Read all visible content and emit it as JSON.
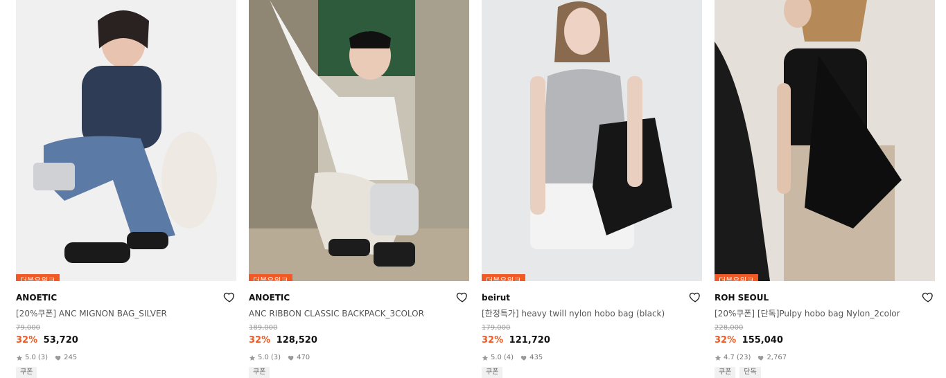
{
  "products": [
    {
      "badge": "더블유위크",
      "brand": "ANOETIC",
      "name": "[20%쿠폰] ANC MIGNON BAG_SILVER",
      "original_price": "79,000",
      "discount": "32%",
      "price": "53,720",
      "rating": "5.0",
      "review_count": "(3)",
      "likes": "245",
      "tags": [
        "쿠폰"
      ],
      "image": {
        "bg": "#f0f0f1",
        "figure": "#2f3c55",
        "accent": "#5c7aa6",
        "bag": "#cfd1d4"
      }
    },
    {
      "badge": "더블유위크",
      "brand": "ANOETIC",
      "name": "ANC RIBBON CLASSIC BACKPACK_3COLOR",
      "original_price": "189,000",
      "discount": "32%",
      "price": "128,520",
      "rating": "5.0",
      "review_count": "(3)",
      "likes": "470",
      "tags": [
        "쿠폰"
      ],
      "image": {
        "bg": "#c9c3b6",
        "figure": "#f2f2f0",
        "accent": "#7aa2b8",
        "bag": "#d8d9db"
      }
    },
    {
      "badge": "더블유위크",
      "brand": "beirut",
      "name": "[한정특가] heavy twill nylon hobo bag (black)",
      "original_price": "179,000",
      "discount": "32%",
      "price": "121,720",
      "rating": "5.0",
      "review_count": "(4)",
      "likes": "435",
      "tags": [
        "쿠폰"
      ],
      "image": {
        "bg": "#e7e8ea",
        "figure": "#b5b6b9",
        "accent": "#f3f3f3",
        "bag": "#161616"
      }
    },
    {
      "badge": "더블유위크",
      "brand": "ROH SEOUL",
      "name": "[20%쿠폰] [단독]Pulpy hobo bag Nylon_2color",
      "original_price": "228,000",
      "discount": "32%",
      "price": "155,040",
      "rating": "4.7",
      "review_count": "(23)",
      "likes": "2,767",
      "tags": [
        "쿠폰",
        "단독"
      ],
      "image": {
        "bg": "#e4dfd8",
        "figure": "#141414",
        "accent": "#c9b9a4",
        "bag": "#0e0e0e"
      }
    }
  ],
  "icons": {
    "heart": "heart-outline-icon",
    "star": "star-icon",
    "like": "heart-filled-icon"
  },
  "colors": {
    "accent": "#f15a24",
    "muted": "#999999"
  }
}
